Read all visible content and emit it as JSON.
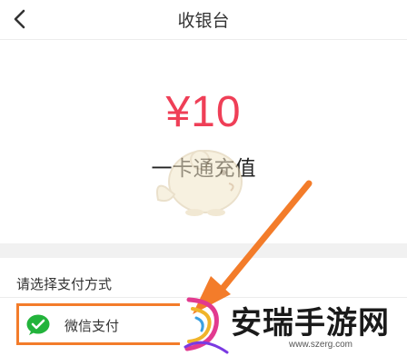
{
  "header": {
    "title": "收银台"
  },
  "order": {
    "amount": "¥10",
    "product": "一卡通充值"
  },
  "payment": {
    "section_title": "请选择支付方式",
    "methods": [
      {
        "label": "微信支付",
        "icon": "wechat-icon"
      }
    ]
  },
  "watermark": {
    "text": "安瑞手游网",
    "url": "www.szerg.com"
  },
  "colors": {
    "amount": "#ef3f57",
    "highlight": "#f37c2a",
    "wechat": "#22b33b"
  }
}
